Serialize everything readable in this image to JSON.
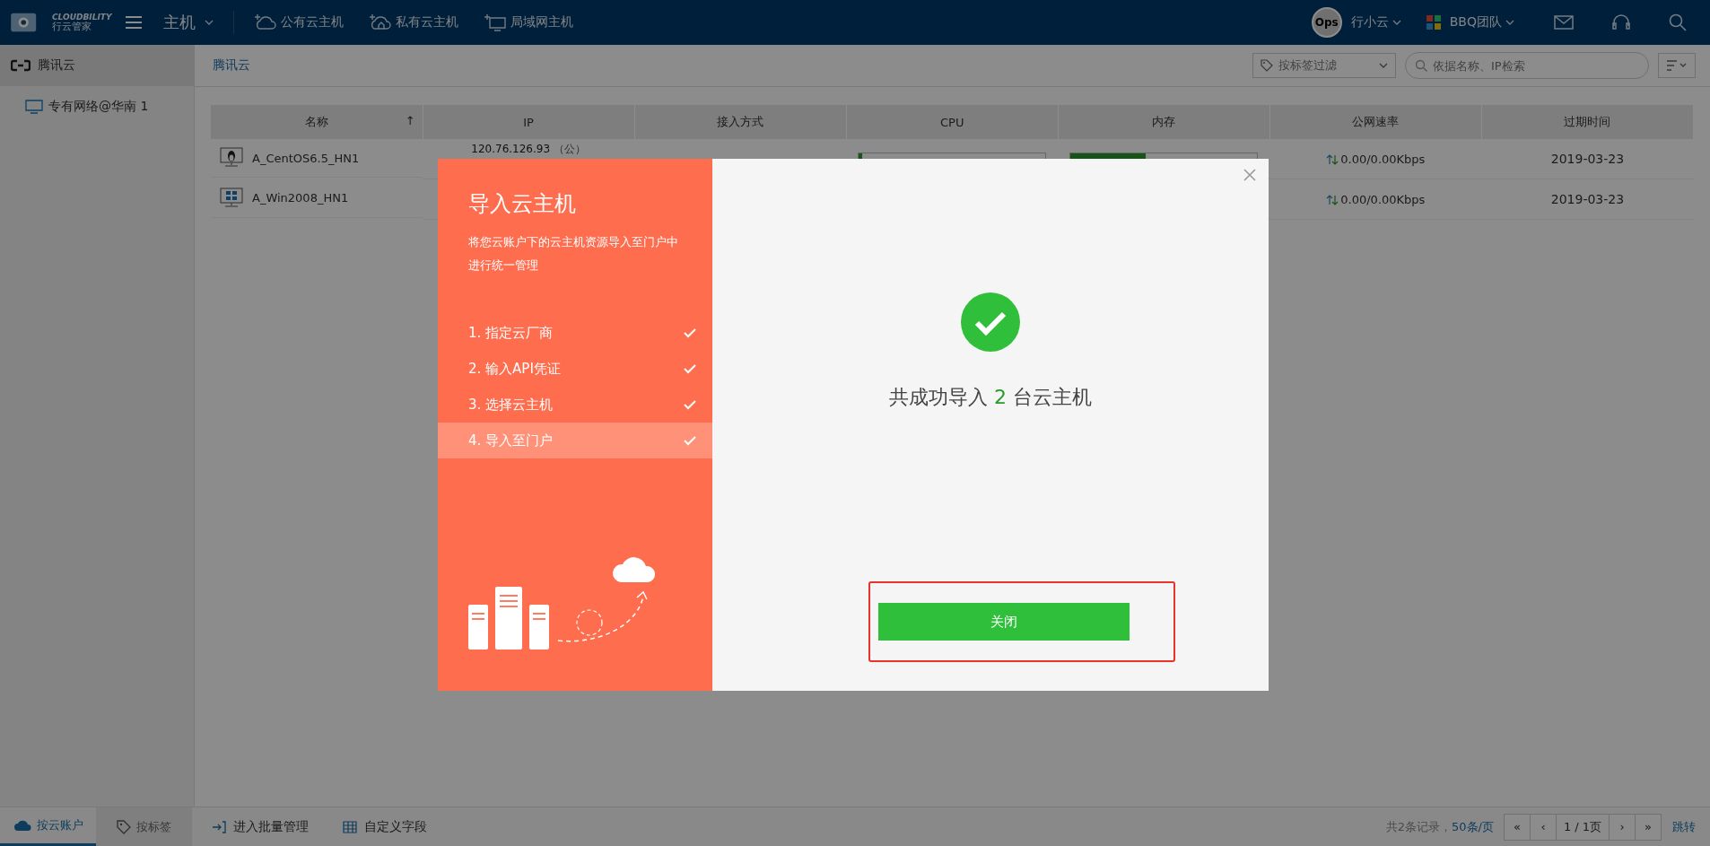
{
  "topbar": {
    "brand": "CLOUDBILITY",
    "brand_sub": "行云管家",
    "section": "主机",
    "nav": [
      {
        "label": "公有云主机"
      },
      {
        "label": "私有云主机"
      },
      {
        "label": "局域网主机"
      }
    ],
    "avatar": "Ops",
    "user": "行小云",
    "team": "BBQ团队"
  },
  "sidebar": {
    "header": "腾讯云",
    "items": [
      {
        "label": "专有网络@华南 1",
        "selected": false
      }
    ]
  },
  "breadcrumb": "腾讯云",
  "toolbar": {
    "tag_filter": "按标签过滤",
    "search_placeholder": "依据名称、IP检索"
  },
  "table": {
    "columns": [
      {
        "label": "名称",
        "sort_arrow": "↑"
      },
      {
        "label": "IP"
      },
      {
        "label": "接入方式"
      },
      {
        "label": "CPU"
      },
      {
        "label": "内存"
      },
      {
        "label": "公网速率"
      },
      {
        "label": "过期时间"
      }
    ],
    "rows": [
      {
        "name": "A_CentOS6.5_HN1",
        "ip": "120.76.126.93",
        "ip_tag": "（公）",
        "cpu": {
          "level": 0.017
        },
        "memory": {
          "level": 0.401
        },
        "speed": "0.00/0.00Kbps",
        "expires": "2019-03-23"
      },
      {
        "name": "A_Win2008_HN1",
        "speed": "0.00/0.00Kbps",
        "expires": "2019-03-23"
      }
    ]
  },
  "bottombar": {
    "tabs": [
      {
        "label": "按云账户",
        "selected": true
      },
      {
        "label": "按标签",
        "selected": false
      }
    ],
    "actions": [
      "进入批量管理",
      "自定义字段"
    ],
    "total": "共2条记录，",
    "page_size": "50条/页",
    "pager": [
      "«",
      "‹",
      "1 / 1页",
      "›",
      "»"
    ],
    "jump": "跳转"
  },
  "modal": {
    "title": "导入云主机",
    "description": "将您云账户下的云主机资源导入至门户中进行统一管理",
    "steps": [
      {
        "label": "1. 指定云厂商",
        "done": true,
        "selected": false
      },
      {
        "label": "2. 输入API凭证",
        "done": true,
        "selected": false
      },
      {
        "label": "3. 选择云主机",
        "done": true,
        "selected": false
      },
      {
        "label": "4. 导入至门户",
        "done": true,
        "selected": true
      }
    ],
    "result_prefix": "共成功导入",
    "result_count": "2",
    "result_suffix": "台云主机",
    "close_button": "关闭",
    "highlighted": true
  }
}
